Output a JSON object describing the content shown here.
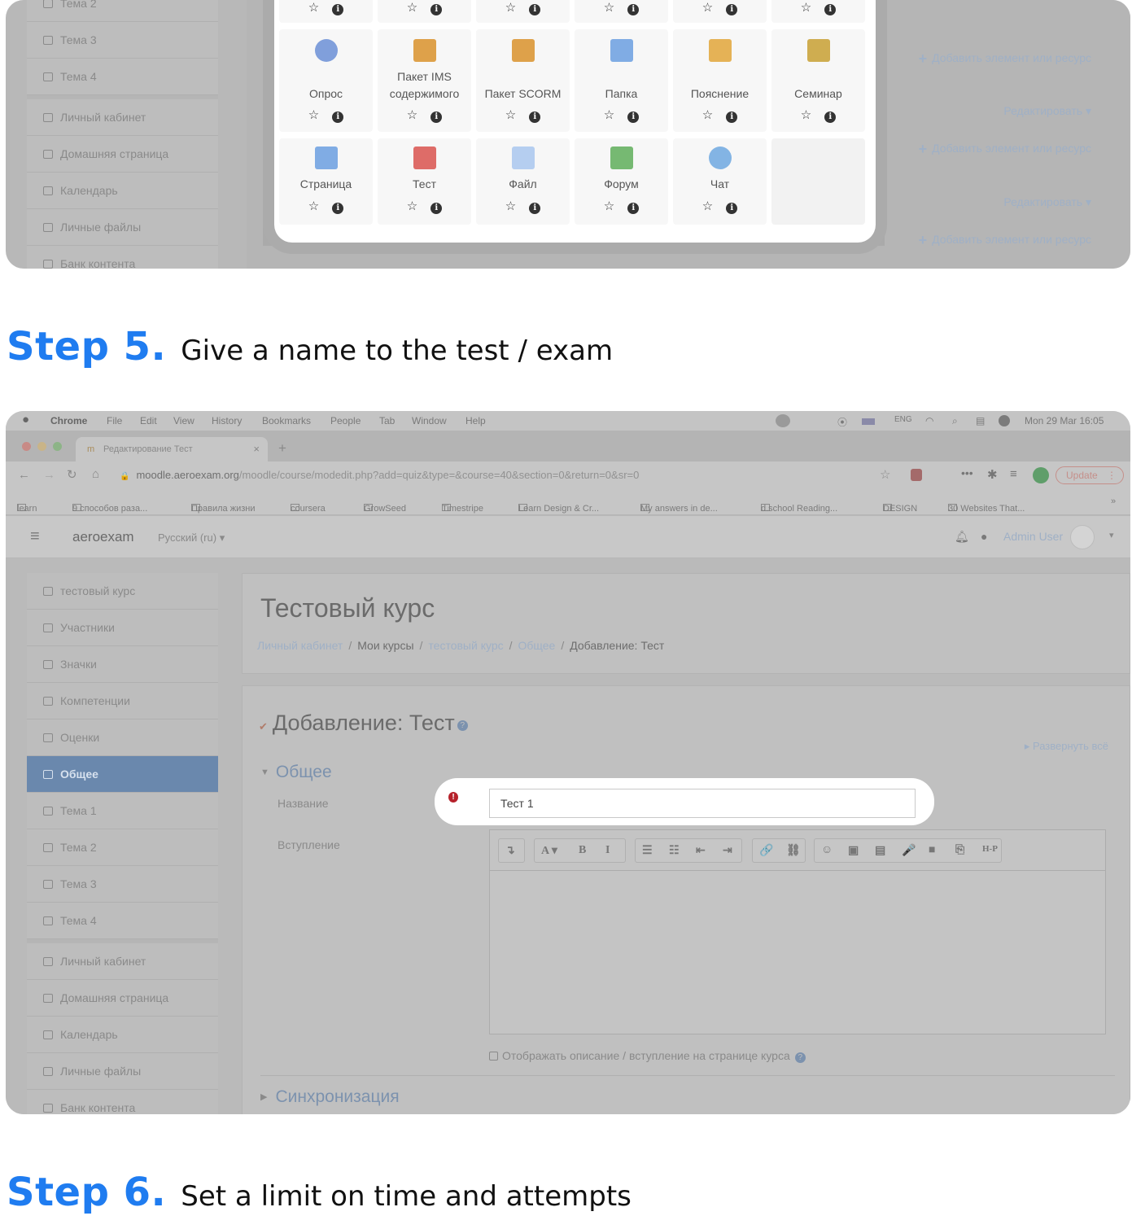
{
  "panel1": {
    "sidebar": [
      "Тема 2",
      "Тема 3",
      "Тема 4",
      "Личный кабинет",
      "Домашняя страница",
      "Календарь",
      "Личные файлы",
      "Банк контента"
    ],
    "right_add_label": "Добавить элемент или ресурс",
    "right_edit_label": "Редактировать",
    "modal_rows": [
      [
        {
          "name": "Опрос",
          "icon": "survey-icon"
        },
        {
          "name": "Пакет IMS содержимого",
          "icon": "ims-package-icon"
        },
        {
          "name": "Пакет SCORM",
          "icon": "scorm-package-icon"
        },
        {
          "name": "Папка",
          "icon": "folder-icon"
        },
        {
          "name": "Пояснение",
          "icon": "label-icon"
        },
        {
          "name": "Семинар",
          "icon": "workshop-icon"
        }
      ],
      [
        {
          "name": "Страница",
          "icon": "page-icon"
        },
        {
          "name": "Тест",
          "icon": "quiz-icon"
        },
        {
          "name": "Файл",
          "icon": "file-icon"
        },
        {
          "name": "Форум",
          "icon": "forum-icon"
        },
        {
          "name": "Чат",
          "icon": "chat-icon"
        }
      ]
    ],
    "star": "☆",
    "info": "i"
  },
  "step5": {
    "number": "Step 5.",
    "text": "Give a name to the test / exam"
  },
  "step6": {
    "number": "Step 6.",
    "text": "Set a limit on time and attempts"
  },
  "browser": {
    "menubar": {
      "apple": "",
      "items": [
        "Chrome",
        "File",
        "Edit",
        "View",
        "History",
        "Bookmarks",
        "People",
        "Tab",
        "Window",
        "Help"
      ],
      "clock": "Mon 29 Mar  16:05"
    },
    "tab_title": "Редактирование Тест",
    "url": "moodle.aeroexam.org/moodle/course/modedit.php?add=quiz&type=&course=40&section=0&return=0&sr=0",
    "url_host": "moodle.aeroexam.org",
    "url_path": "/moodle/course/modedit.php?add=quiz&type=&course=40&section=0&return=0&sr=0",
    "update_label": "Update",
    "bookmarks": [
      "learn",
      "9 способов раза...",
      "Правила жизни",
      "coursera",
      "GrowSeed",
      "Timestripe",
      "Learn Design & Cr...",
      "My answers in de...",
      "d.school Reading...",
      "DESIGN",
      "30 Websites That..."
    ]
  },
  "moodle": {
    "site_name": "aeroexam",
    "language": "Русский (ru)",
    "user": "Admin User",
    "sidebar": [
      {
        "label": "тестовый курс",
        "icon": "graduation-cap-icon"
      },
      {
        "label": "Участники",
        "icon": "users-icon"
      },
      {
        "label": "Значки",
        "icon": "shield-icon"
      },
      {
        "label": "Компетенции",
        "icon": "checkbox-icon"
      },
      {
        "label": "Оценки",
        "icon": "table-icon"
      },
      {
        "label": "Общее",
        "icon": "folder-icon",
        "selected": true
      },
      {
        "label": "Тема 1",
        "icon": "folder-icon"
      },
      {
        "label": "Тема 2",
        "icon": "folder-icon"
      },
      {
        "label": "Тема 3",
        "icon": "folder-icon"
      },
      {
        "label": "Тема 4",
        "icon": "folder-icon"
      }
    ],
    "sidebar2": [
      {
        "label": "Личный кабинет",
        "icon": "dashboard-icon"
      },
      {
        "label": "Домашняя страница",
        "icon": "home-icon"
      },
      {
        "label": "Календарь",
        "icon": "calendar-icon"
      },
      {
        "label": "Личные файлы",
        "icon": "file-icon"
      },
      {
        "label": "Банк контента",
        "icon": "pen-icon"
      }
    ],
    "course_title": "Тестовый курс",
    "breadcrumb": [
      "Личный кабинет",
      "Мои курсы",
      "тестовый курс",
      "Общее",
      "Добавление: Тест"
    ],
    "form_title": "Добавление: Тест",
    "expand_all": "Развернуть всё",
    "section_general": "Общее",
    "name_label": "Название",
    "name_value": "Тест 1",
    "intro_label": "Вступление",
    "show_desc_label": "Отображать описание / вступление на странице курса",
    "section_sync": "Синхронизация",
    "toolbar": [
      "↴",
      "A ▾",
      "B",
      "I",
      "☰",
      "☷",
      "⇤",
      "⇥",
      "🔗",
      "⛓",
      "☺",
      "▣",
      "▤",
      "🎤",
      "■",
      "⎘",
      "H-P"
    ]
  }
}
